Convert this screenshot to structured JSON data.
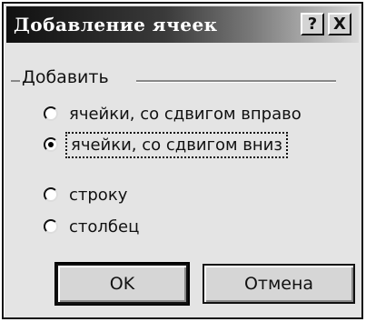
{
  "window": {
    "title": "Добавление ячеек",
    "help_label": "?",
    "close_label": "X"
  },
  "group": {
    "label": "Добавить",
    "options": [
      {
        "label": "ячейки, со сдвигом вправо",
        "selected": false
      },
      {
        "label": "ячейки, со сдвигом вниз",
        "selected": true
      },
      {
        "label": "строку",
        "selected": false
      },
      {
        "label": "столбец",
        "selected": false
      }
    ]
  },
  "buttons": {
    "ok": "OK",
    "cancel": "Отмена"
  }
}
